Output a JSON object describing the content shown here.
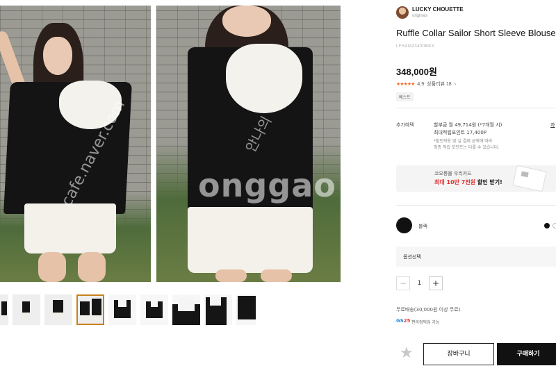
{
  "seller": {
    "name": "LUCKY CHOUETTE",
    "sub": "originals"
  },
  "product": {
    "title": "Ruffle Collar Sailor Short Sleeve Blouse",
    "code": "LFSAM23400BKX",
    "price": "348,000원",
    "rating_stars": "★★★★★",
    "rating_value": "4.9",
    "review_text": "상품리뷰 18",
    "review_arrow": "›",
    "badge": "베스트"
  },
  "benefits": {
    "label": "추가혜택",
    "line1": "할부금 월 49,714원 (*7개월 시)",
    "line2": "최대적립포인트 17,400P",
    "note1": "*할인적용 및 실 결제 금액에 따라",
    "note2": "최종 적립 포인트는 다를 수 있습니다.",
    "link": "자"
  },
  "card_banner": {
    "line1": "코오롱몰 우리카드",
    "highlight": "최대 10만 7천원",
    "suffix": " 할인 받기!"
  },
  "color_option": {
    "name": "블랙"
  },
  "option_select": {
    "label": "옵션선택"
  },
  "quantity": {
    "minus": "−",
    "value": "1",
    "plus": "+"
  },
  "shipping": {
    "text": "무료배송(30,000원 이상 무료)",
    "gs_logo": "GS",
    "gs_logo_num": "25",
    "gs_text": "편의점픽업 가능"
  },
  "actions": {
    "favorite": "★",
    "cart": "장바구니",
    "buy": "구매하기"
  },
  "watermark": {
    "brand": "onggao",
    "cafe": "cafe.naver.com",
    "korean": "안나의"
  },
  "colors": {
    "accent_red": "#e03131",
    "star_orange": "#f26b2a",
    "thumb_active": "#c8811c"
  }
}
